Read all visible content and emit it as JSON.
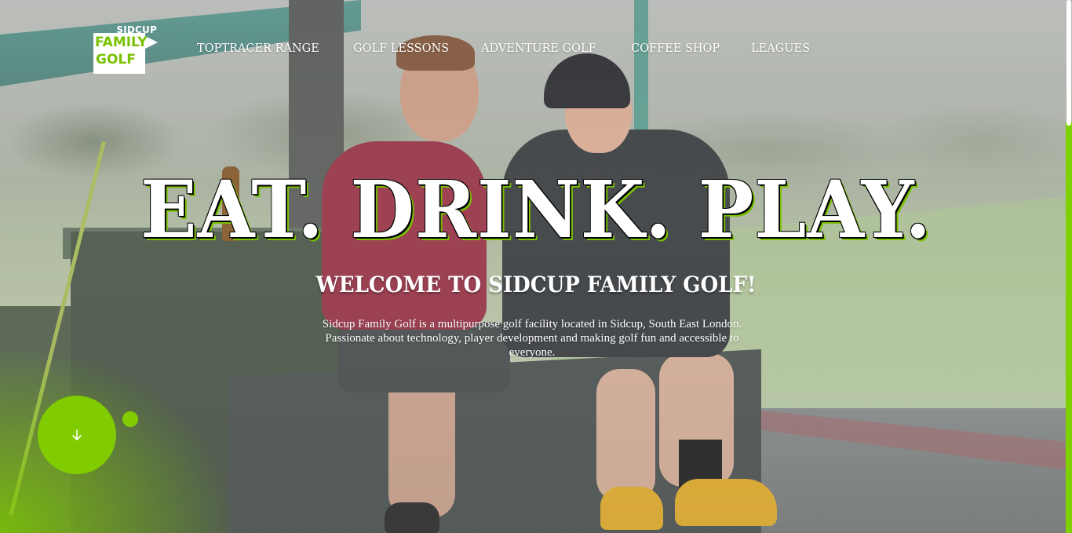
{
  "logo": {
    "top_text": "SIDCUP",
    "line1": "FAMILY",
    "line2": "GOLF"
  },
  "nav": {
    "items": [
      {
        "label": "TOPTRACER RANGE"
      },
      {
        "label": "GOLF LESSONS"
      },
      {
        "label": "ADVENTURE GOLF"
      },
      {
        "label": "COFFEE SHOP"
      },
      {
        "label": "LEAGUES"
      }
    ]
  },
  "hero": {
    "title": "EAT. DRINK. PLAY.",
    "subtitle": "WELCOME TO SIDCUP FAMILY GOLF!",
    "description": "Sidcup Family Golf is a multipurpose golf facility located in Sidcup, South East London. Passionate about technology, player development and making golf fun and accessible to everyone."
  },
  "scroll_button": {
    "icon": "arrow-down-icon"
  },
  "colors": {
    "brand_green": "#80cc00",
    "logo_green": "#7ac100",
    "text": "#ffffff"
  }
}
